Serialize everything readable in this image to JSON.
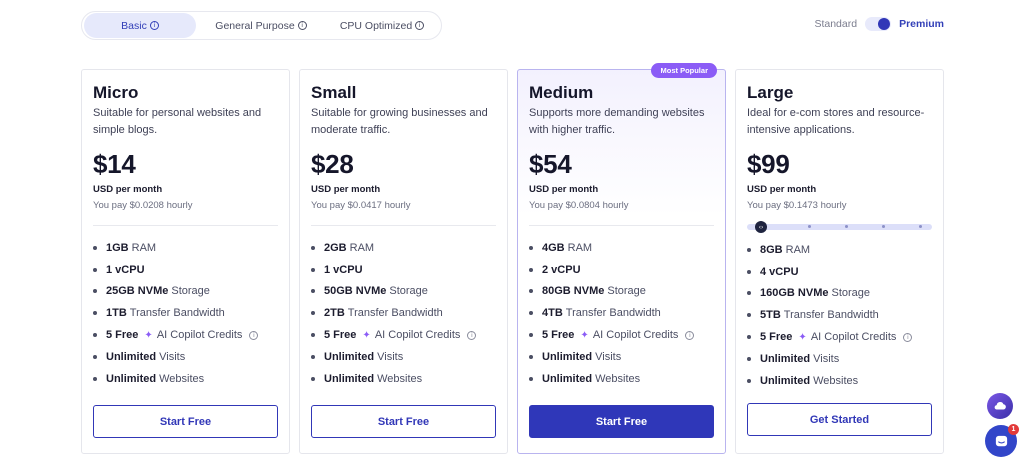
{
  "tabs": [
    {
      "label": "Basic",
      "active": true
    },
    {
      "label": "General Purpose",
      "active": false
    },
    {
      "label": "CPU Optimized",
      "active": false
    }
  ],
  "toggle": {
    "left": "Standard",
    "right": "Premium",
    "selected": "Premium"
  },
  "plans": [
    {
      "name": "Micro",
      "desc": "Suitable for personal websites and simple blogs.",
      "price": "$14",
      "per": "USD per month",
      "hourly": "You pay $0.0208 hourly",
      "features": [
        {
          "strong": "1GB",
          "text": "RAM"
        },
        {
          "strong": "1 vCPU",
          "text": ""
        },
        {
          "strong": "25GB NVMe",
          "text": "Storage"
        },
        {
          "strong": "1TB",
          "text": "Transfer Bandwidth"
        },
        {
          "strong": "5 Free",
          "text": "AI Copilot Credits"
        },
        {
          "strong": "Unlimited",
          "text": "Visits"
        },
        {
          "strong": "Unlimited",
          "text": "Websites"
        }
      ],
      "cta": "Start Free"
    },
    {
      "name": "Small",
      "desc": "Suitable for growing businesses and moderate traffic.",
      "price": "$28",
      "per": "USD per month",
      "hourly": "You pay $0.0417 hourly",
      "features": [
        {
          "strong": "2GB",
          "text": "RAM"
        },
        {
          "strong": "1 vCPU",
          "text": ""
        },
        {
          "strong": "50GB NVMe",
          "text": "Storage"
        },
        {
          "strong": "2TB",
          "text": "Transfer Bandwidth"
        },
        {
          "strong": "5 Free",
          "text": "AI Copilot Credits"
        },
        {
          "strong": "Unlimited",
          "text": "Visits"
        },
        {
          "strong": "Unlimited",
          "text": "Websites"
        }
      ],
      "cta": "Start Free"
    },
    {
      "name": "Medium",
      "badge": "Most Popular",
      "desc": "Supports more demanding websites with higher traffic.",
      "price": "$54",
      "per": "USD per month",
      "hourly": "You pay $0.0804 hourly",
      "features": [
        {
          "strong": "4GB",
          "text": "RAM"
        },
        {
          "strong": "2 vCPU",
          "text": ""
        },
        {
          "strong": "80GB NVMe",
          "text": "Storage"
        },
        {
          "strong": "4TB",
          "text": "Transfer Bandwidth"
        },
        {
          "strong": "5 Free",
          "text": "AI Copilot Credits"
        },
        {
          "strong": "Unlimited",
          "text": "Visits"
        },
        {
          "strong": "Unlimited",
          "text": "Websites"
        }
      ],
      "cta": "Start Free"
    },
    {
      "name": "Large",
      "desc": "Ideal for e-com stores and resource-intensive applications.",
      "price": "$99",
      "per": "USD per month",
      "hourly": "You pay $0.1473 hourly",
      "features": [
        {
          "strong": "8GB",
          "text": "RAM"
        },
        {
          "strong": "4 vCPU",
          "text": ""
        },
        {
          "strong": "160GB NVMe",
          "text": "Storage"
        },
        {
          "strong": "5TB",
          "text": "Transfer Bandwidth"
        },
        {
          "strong": "5 Free",
          "text": "AI Copilot Credits"
        },
        {
          "strong": "Unlimited",
          "text": "Visits"
        },
        {
          "strong": "Unlimited",
          "text": "Websites"
        }
      ],
      "cta": "Get Started"
    }
  ],
  "chat": {
    "unread": "1"
  },
  "colors": {
    "brand": "#3137b7",
    "badge": "#8b5cf6",
    "notif": "#e33a3a"
  }
}
